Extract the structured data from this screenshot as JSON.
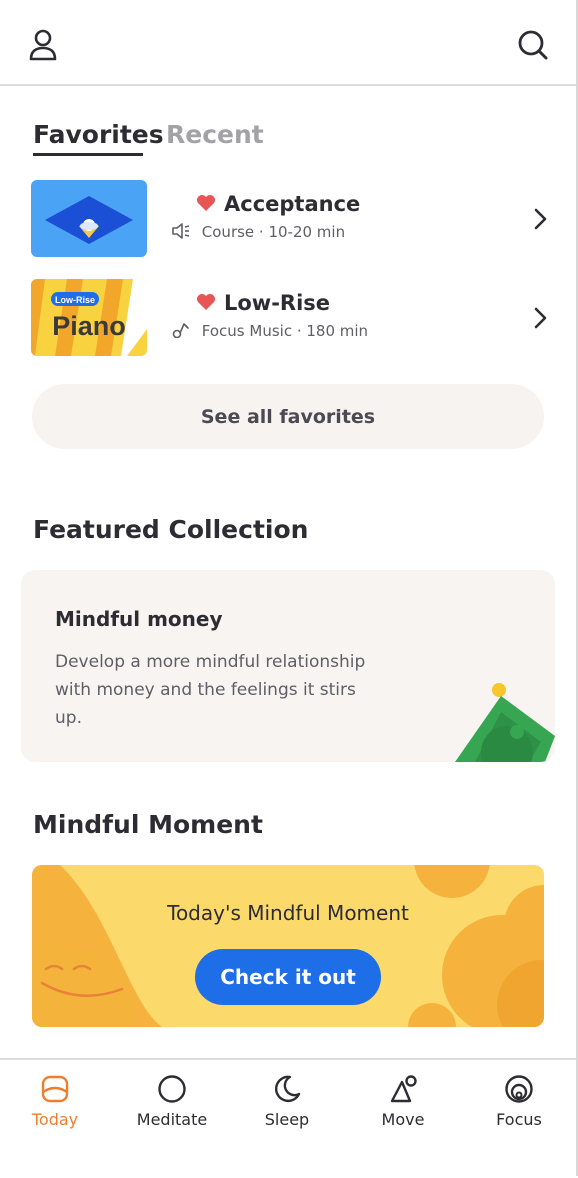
{
  "header": {
    "profile_icon": "person-icon",
    "search_icon": "search-icon"
  },
  "tabs": [
    {
      "label": "Favorites",
      "active": true
    },
    {
      "label": "Recent",
      "active": false
    }
  ],
  "favorites": [
    {
      "title": "Acceptance",
      "type_icon": "course-speaker-icon",
      "meta": "Course · 10-20 min"
    },
    {
      "title": "Low-Rise",
      "type_icon": "music-note-icon",
      "meta": "Focus Music · 180 min",
      "thumb_badge": "Low-Rise",
      "thumb_text": "Piano"
    }
  ],
  "see_all_label": "See all favorites",
  "featured": {
    "section_title": "Featured Collection",
    "title": "Mindful money",
    "description": "Develop a more mindful relationship with money and the feelings it stirs up."
  },
  "moment": {
    "section_title": "Mindful Moment",
    "text": "Today's Mindful Moment",
    "button_label": "Check it out"
  },
  "nav": [
    {
      "label": "Today",
      "icon": "today-icon",
      "active": true
    },
    {
      "label": "Meditate",
      "icon": "meditate-icon",
      "active": false
    },
    {
      "label": "Sleep",
      "icon": "moon-icon",
      "active": false
    },
    {
      "label": "Move",
      "icon": "move-icon",
      "active": false
    },
    {
      "label": "Focus",
      "icon": "focus-icon",
      "active": false
    }
  ],
  "colors": {
    "accent_orange": "#ef7e2c",
    "heart_red": "#e85555",
    "button_blue": "#1e6ee8",
    "moment_yellow": "#fbd96a"
  }
}
